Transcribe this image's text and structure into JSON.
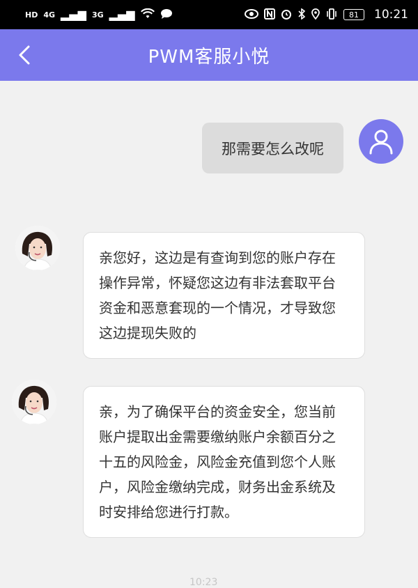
{
  "status_bar": {
    "left_label": "HD",
    "net1": "4G",
    "net2": "3G",
    "battery": "81",
    "time": "10:21"
  },
  "header": {
    "title": "PWM客服小悦"
  },
  "messages": [
    {
      "sender": "user",
      "text": "那需要怎么改呢"
    },
    {
      "sender": "agent",
      "text": "亲您好，这边是有查询到您的账户存在操作异常，怀疑您这边有非法套取平台资金和恶意套现的一个情况，才导致您这边提现失败的"
    },
    {
      "sender": "agent",
      "text": "亲，为了确保平台的资金安全，您当前账户提取出金需要缴纳账户余额百分之十五的风险金，风险金充值到您个人账户，风险金缴纳完成，财务出金系统及时安排给您进行打款。"
    }
  ],
  "bottom_time": "10:23",
  "colors": {
    "header": "#7b79ec",
    "background": "#f1f1f1",
    "user_bubble": "#dcdcdc"
  }
}
